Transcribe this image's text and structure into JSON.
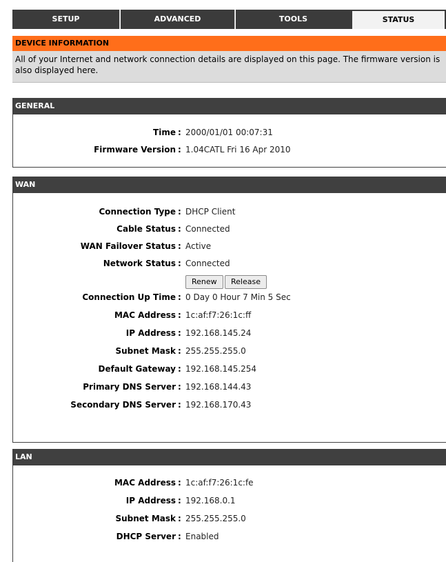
{
  "tabs": [
    "SETUP",
    "ADVANCED",
    "TOOLS",
    "STATUS"
  ],
  "device_info": {
    "header": "DEVICE INFORMATION",
    "description": "All of your Internet and network connection details are displayed on this page. The firmware version is also displayed here."
  },
  "general": {
    "header": "GENERAL",
    "rows": [
      {
        "label": "Time",
        "value": "2000/01/01 00:07:31"
      },
      {
        "label": "Firmware Version",
        "value": "1.04CATL Fri 16 Apr 2010"
      }
    ]
  },
  "wan": {
    "header": "WAN",
    "rows_top": [
      {
        "label": "Connection Type",
        "value": "DHCP Client"
      },
      {
        "label": "Cable Status",
        "value": "Connected"
      },
      {
        "label": "WAN Failover Status",
        "value": "Active"
      },
      {
        "label": "Network Status",
        "value": "Connected"
      }
    ],
    "renew_label": "Renew",
    "release_label": "Release",
    "rows_bottom": [
      {
        "label": "Connection Up Time",
        "value": "0 Day 0 Hour 7 Min 5 Sec"
      },
      {
        "label": "MAC Address",
        "value": "1c:af:f7:26:1c:ff"
      },
      {
        "label": "IP Address",
        "value": "192.168.145.24"
      },
      {
        "label": "Subnet Mask",
        "value": "255.255.255.0"
      },
      {
        "label": "Default Gateway",
        "value": "192.168.145.254"
      },
      {
        "label": "Primary DNS Server",
        "value": "192.168.144.43"
      },
      {
        "label": "Secondary DNS Server",
        "value": "192.168.170.43"
      }
    ]
  },
  "lan": {
    "header": "LAN",
    "rows": [
      {
        "label": "MAC Address",
        "value": "1c:af:f7:26:1c:fe"
      },
      {
        "label": "IP Address",
        "value": "192.168.0.1"
      },
      {
        "label": "Subnet Mask",
        "value": "255.255.255.0"
      },
      {
        "label": "DHCP Server",
        "value": "Enabled"
      }
    ]
  },
  "colon": ":"
}
